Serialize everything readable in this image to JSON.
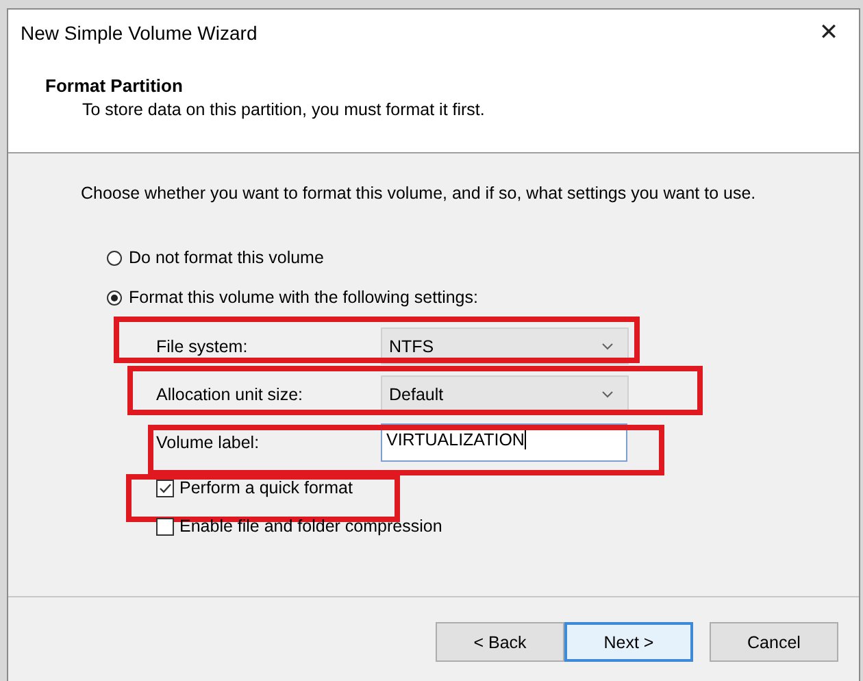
{
  "window": {
    "title": "New Simple Volume Wizard",
    "close": "✕"
  },
  "header": {
    "title": "Format Partition",
    "subtitle": "To store data on this partition, you must format it first."
  },
  "instruction": "Choose whether you want to format this volume, and if so, what settings you want to use.",
  "options": [
    {
      "label": "Do not format this volume",
      "selected": false
    },
    {
      "label": "Format this volume with the following settings:",
      "selected": true
    }
  ],
  "settings": [
    {
      "kind": "dropdown",
      "label": "File system:",
      "value": "NTFS",
      "highlighted": true
    },
    {
      "kind": "dropdown",
      "label": "Allocation unit size:",
      "value": "Default",
      "highlighted": true
    },
    {
      "kind": "text",
      "label": "Volume label:",
      "value": "VIRTUALIZATION",
      "highlighted": true
    }
  ],
  "checkboxes": [
    {
      "label": "Perform a quick format",
      "checked": true,
      "highlighted": true
    },
    {
      "label": "Enable file and folder compression",
      "checked": false,
      "highlighted": false
    }
  ],
  "buttons": [
    {
      "label": "< Back",
      "selected": false
    },
    {
      "label": "Next >",
      "selected": true
    },
    {
      "label": "Cancel",
      "selected": false
    }
  ]
}
